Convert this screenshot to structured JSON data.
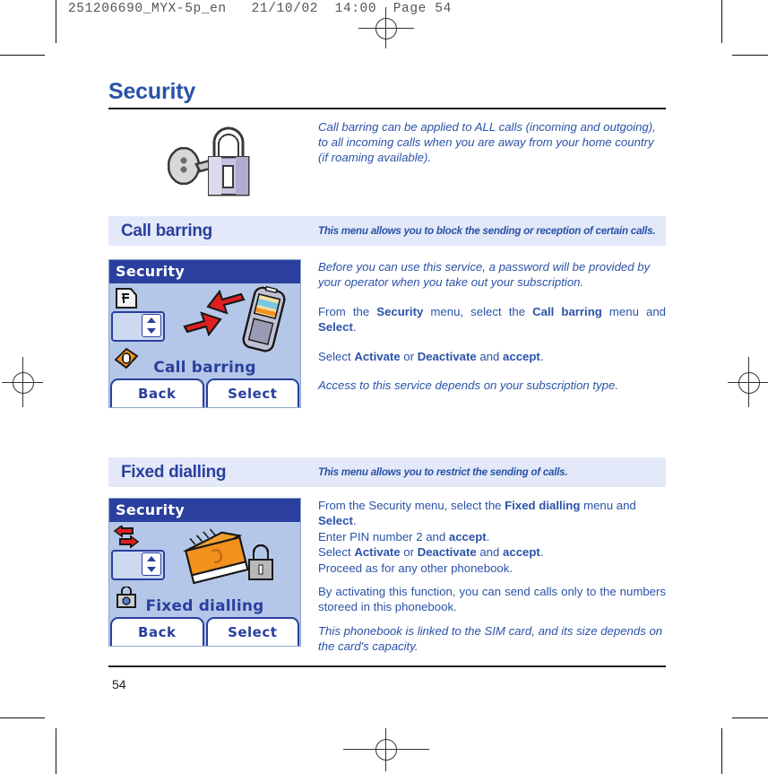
{
  "prepress": {
    "header": "251206690_MYX-5p_en   21/10/02  14:00  Page 54"
  },
  "document": {
    "title": "Security",
    "folio": "54",
    "intro": {
      "art_icon": "padlock-with-key-icon",
      "text": "Call barring can be applied to ALL calls (incoming and outgoing), to all incoming calls when you are away from your home country (if roaming available)."
    },
    "sections": [
      {
        "id": "call-barring",
        "band_title": "Call barring",
        "band_subtitle": "This menu allows you to block the sending or reception of certain calls.",
        "screenshot": {
          "title": "Security",
          "label": "Call barring",
          "softkey_left": "Back",
          "softkey_right": "Select",
          "icons": [
            "sim-card-icon",
            "call-barring-arrows-icon",
            "pin-lock-icon"
          ],
          "main_icon": "phone-with-barred-arrows-icon",
          "selected_index": 1
        },
        "paragraphs": [
          {
            "style": "italic",
            "runs": [
              {
                "text": "Before you can use this service, a password will be provided by your operator when you take out your subscription.",
                "bold": false
              }
            ]
          },
          {
            "style": "normal-justified",
            "runs": [
              {
                "text": "From the ",
                "bold": false
              },
              {
                "text": "Security",
                "bold": true
              },
              {
                "text": " menu, select the ",
                "bold": false
              },
              {
                "text": "Call barring",
                "bold": true
              },
              {
                "text": " menu and ",
                "bold": false
              },
              {
                "text": "Select",
                "bold": true
              },
              {
                "text": ".",
                "bold": false
              }
            ]
          },
          {
            "style": "normal",
            "runs": [
              {
                "text": "Select ",
                "bold": false
              },
              {
                "text": "Activate",
                "bold": true
              },
              {
                "text": " or ",
                "bold": false
              },
              {
                "text": "Deactivate",
                "bold": true
              },
              {
                "text": " and ",
                "bold": false
              },
              {
                "text": "accept",
                "bold": true
              },
              {
                "text": ".",
                "bold": false
              }
            ]
          },
          {
            "style": "italic",
            "runs": [
              {
                "text": "Access to this service depends on your subscription type.",
                "bold": false
              }
            ]
          }
        ]
      },
      {
        "id": "fixed-dialling",
        "band_title": "Fixed dialling",
        "band_subtitle": "This menu allows you to restrict the sending of calls.",
        "screenshot": {
          "title": "Security",
          "label": "Fixed dialling",
          "softkey_left": "Back",
          "softkey_right": "Select",
          "icons": [
            "call-barring-arrows-icon",
            "pin-lock-icon",
            "fixed-dialling-padlock-icon"
          ],
          "main_icon": "phonebook-with-padlock-icon",
          "selected_index": 1
        },
        "paragraphs": [
          {
            "style": "normal",
            "runs": [
              {
                "text": "From the Security menu, select the ",
                "bold": false
              },
              {
                "text": "Fixed dialling",
                "bold": true
              },
              {
                "text": " menu and ",
                "bold": false
              },
              {
                "text": "Select",
                "bold": true
              },
              {
                "text": ".",
                "bold": false
              }
            ]
          },
          {
            "style": "normal",
            "runs": [
              {
                "text": "Enter PIN number 2 and ",
                "bold": false
              },
              {
                "text": "accept",
                "bold": true
              },
              {
                "text": ".",
                "bold": false
              }
            ]
          },
          {
            "style": "normal",
            "runs": [
              {
                "text": "Select ",
                "bold": false
              },
              {
                "text": "Activate",
                "bold": true
              },
              {
                "text": " or ",
                "bold": false
              },
              {
                "text": "Deactivate",
                "bold": true
              },
              {
                "text": " and ",
                "bold": false
              },
              {
                "text": "accept",
                "bold": true
              },
              {
                "text": ".",
                "bold": false
              }
            ]
          },
          {
            "style": "normal",
            "runs": [
              {
                "text": "Proceed as for any other phonebook.",
                "bold": false
              }
            ]
          },
          {
            "style": "normal",
            "runs": [
              {
                "text": "By activating this function, you can send calls only to the numbers storeed in this phonebook.",
                "bold": false
              }
            ]
          },
          {
            "style": "italic",
            "runs": [
              {
                "text": "This phonebook is linked to the SIM card, and its size depends on the card's capacity.",
                "bold": false
              }
            ]
          }
        ]
      }
    ]
  },
  "colors": {
    "brand_blue": "#2a52a8",
    "heading_blue": "#2a3f9e",
    "band_bg": "#e3e9f8",
    "lcd_bg": "#b5c7e8",
    "rule": "#1a1a1a"
  }
}
